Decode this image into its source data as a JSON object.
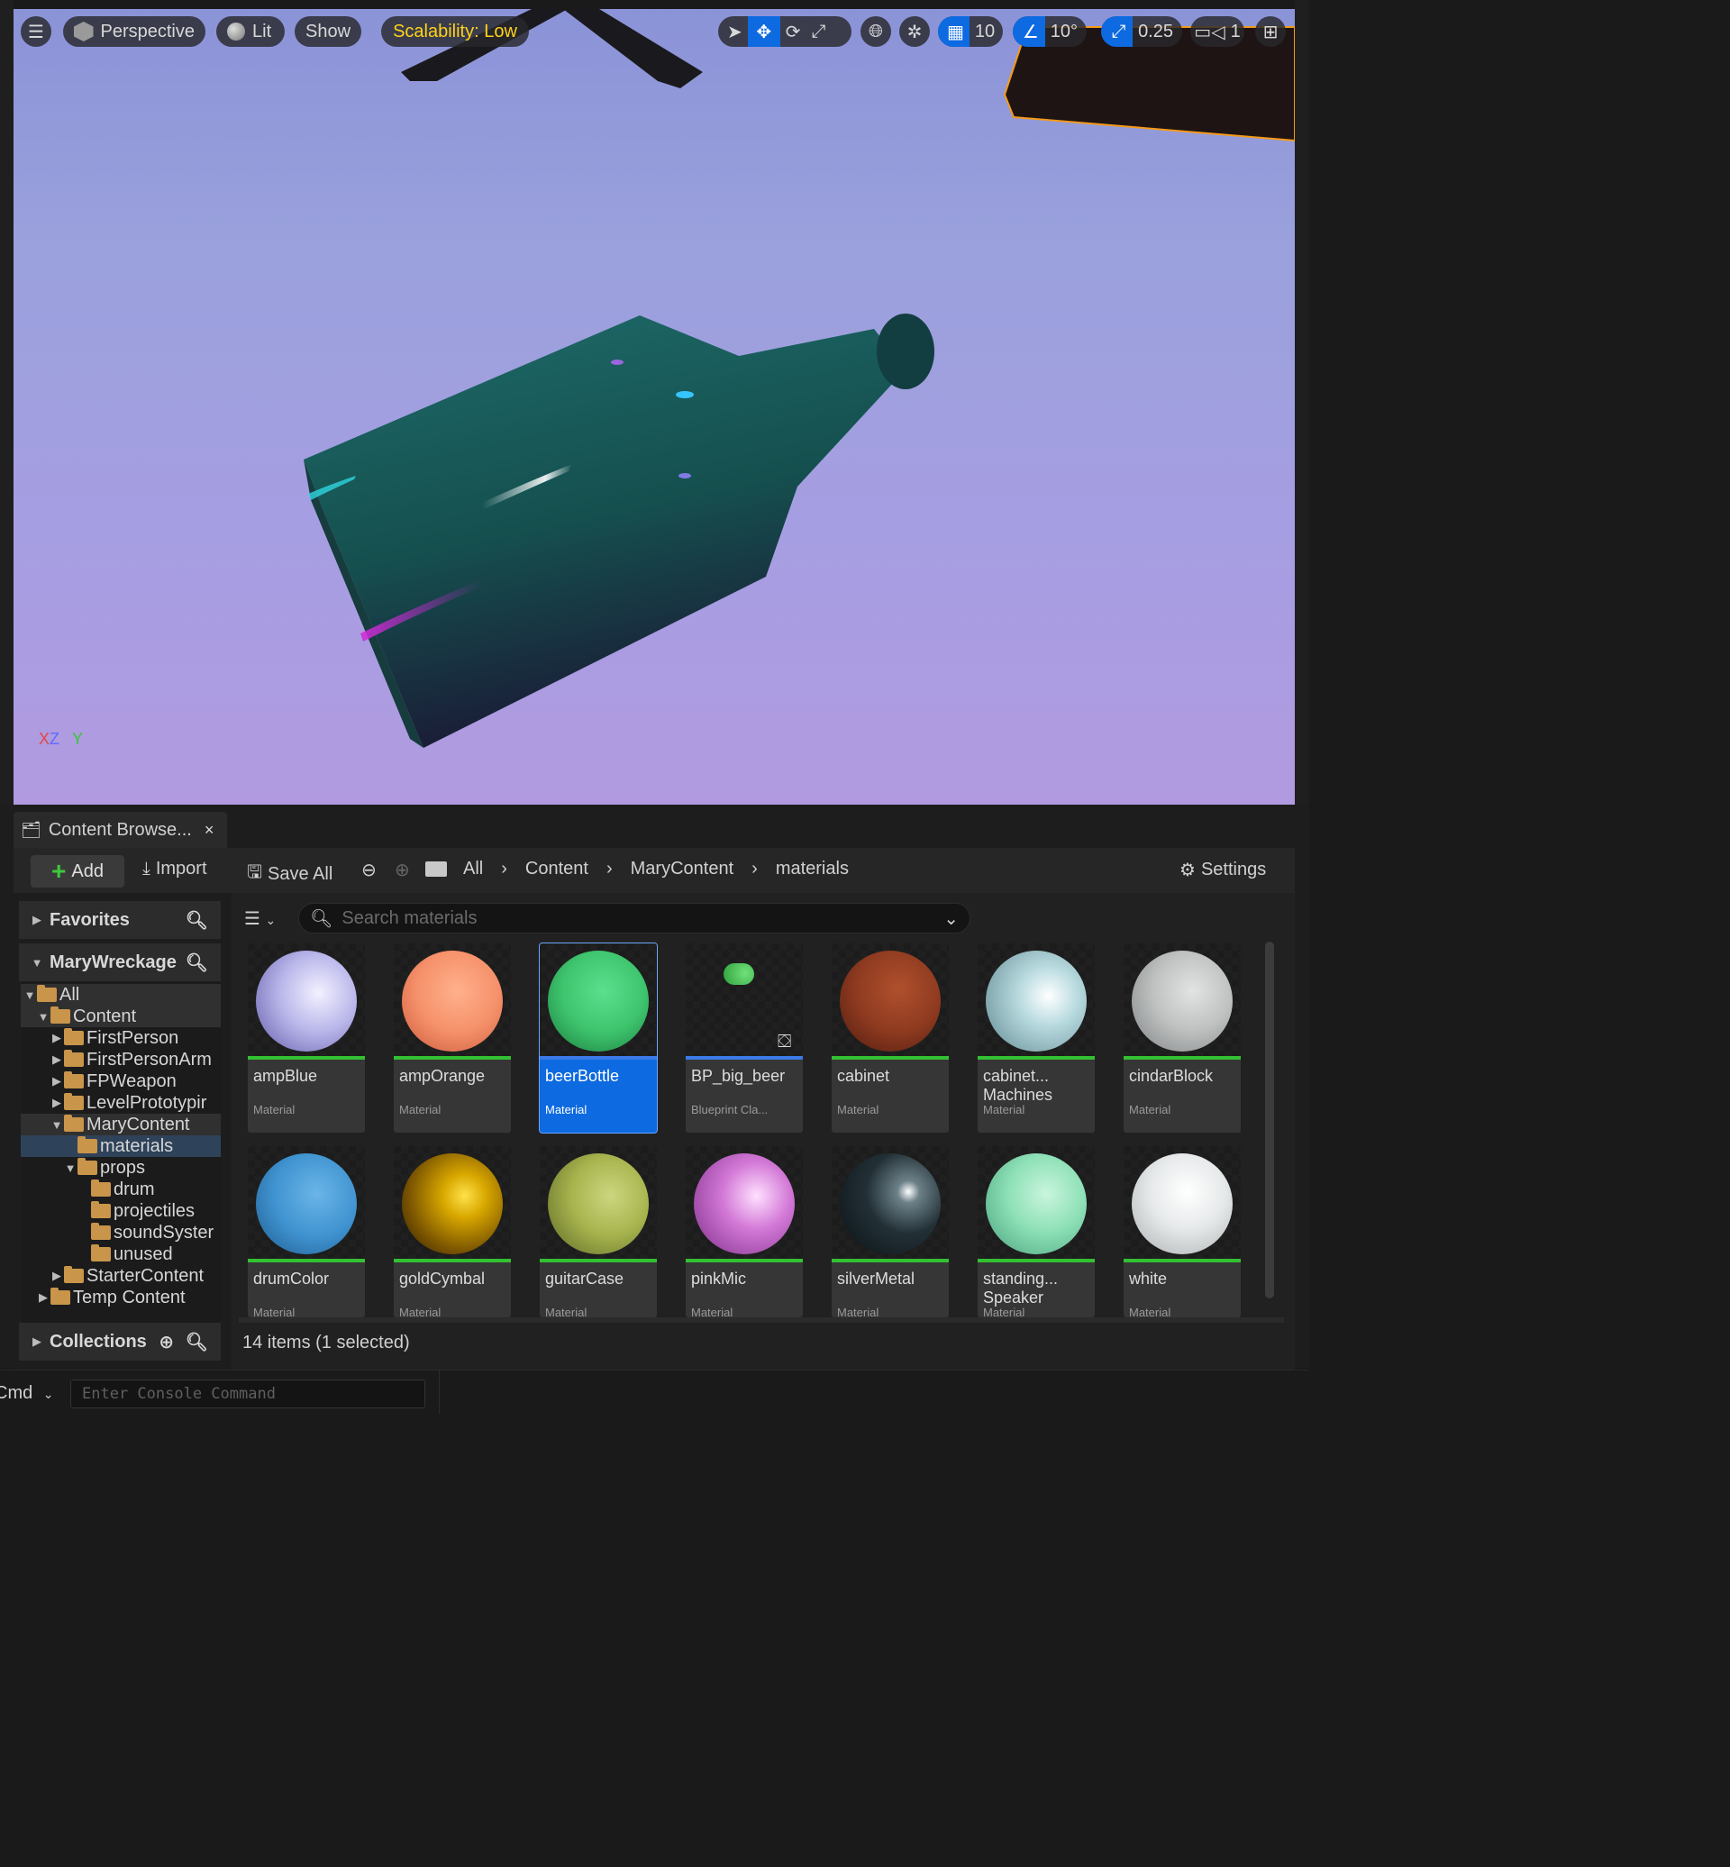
{
  "viewport": {
    "menu_icon": "hamburger-icon",
    "perspective_label": "Perspective",
    "lit_label": "Lit",
    "show_label": "Show",
    "scalability_label": "Scalability: Low",
    "grid_value": "10",
    "angle_value": "10°",
    "scale_value": "0.25",
    "camera_speed": "1",
    "axis": {
      "x": "X",
      "z": "Z",
      "y": "Y"
    }
  },
  "content_browser": {
    "tab_label": "Content Browse...",
    "tab_close": "×",
    "toolbar": {
      "add_label": "Add",
      "import_label": "Import",
      "save_all_label": "Save All",
      "settings_label": "Settings"
    },
    "breadcrumb": [
      "All",
      "Content",
      "MaryContent",
      "materials"
    ],
    "sidebar": {
      "favorites_label": "Favorites",
      "project_label": "MaryWreckage",
      "collections_label": "Collections",
      "tree": [
        {
          "label": "All"
        },
        {
          "label": "Content"
        },
        {
          "label": "FirstPerson"
        },
        {
          "label": "FirstPersonArm"
        },
        {
          "label": "FPWeapon"
        },
        {
          "label": "LevelPrototypir"
        },
        {
          "label": "MaryContent"
        },
        {
          "label": "materials"
        },
        {
          "label": "props"
        },
        {
          "label": "drum"
        },
        {
          "label": "projectiles"
        },
        {
          "label": "soundSyster"
        },
        {
          "label": "unused"
        },
        {
          "label": "StarterContent"
        },
        {
          "label": "Temp Content"
        }
      ]
    },
    "search_placeholder": "Search materials",
    "assets": [
      {
        "name": "ampBlue",
        "type": "Material",
        "color": "#b9b6ea"
      },
      {
        "name": "ampOrange",
        "type": "Material",
        "color": "#f5916a"
      },
      {
        "name": "beerBottle",
        "type": "Material",
        "color": "#3ec46d"
      },
      {
        "name": "BP_big_beer",
        "type": "Blueprint Cla...",
        "color": "#3bbf4a"
      },
      {
        "name": "cabinet",
        "type": "Material",
        "color": "#8e3a20"
      },
      {
        "name": "cabinet... Machines",
        "type": "Material",
        "color": "#b9dbe0"
      },
      {
        "name": "cindarBlock",
        "type": "Material",
        "color": "#c0c2c2"
      },
      {
        "name": "drumColor",
        "type": "Material",
        "color": "#3f93d0"
      },
      {
        "name": "goldCymbal",
        "type": "Material",
        "color": "#a07600"
      },
      {
        "name": "guitarCase",
        "type": "Material",
        "color": "#a8b54e"
      },
      {
        "name": "pinkMic",
        "type": "Material",
        "color": "#d277d6"
      },
      {
        "name": "silverMetal",
        "type": "Material",
        "color": "#223036"
      },
      {
        "name": "standing... Speaker",
        "type": "Material",
        "color": "#8de0b6"
      },
      {
        "name": "white",
        "type": "Material",
        "color": "#e6e9ea"
      }
    ],
    "status": "14 items (1 selected)"
  },
  "console": {
    "cmd_label": "Cmd",
    "placeholder": "Enter Console Command"
  }
}
